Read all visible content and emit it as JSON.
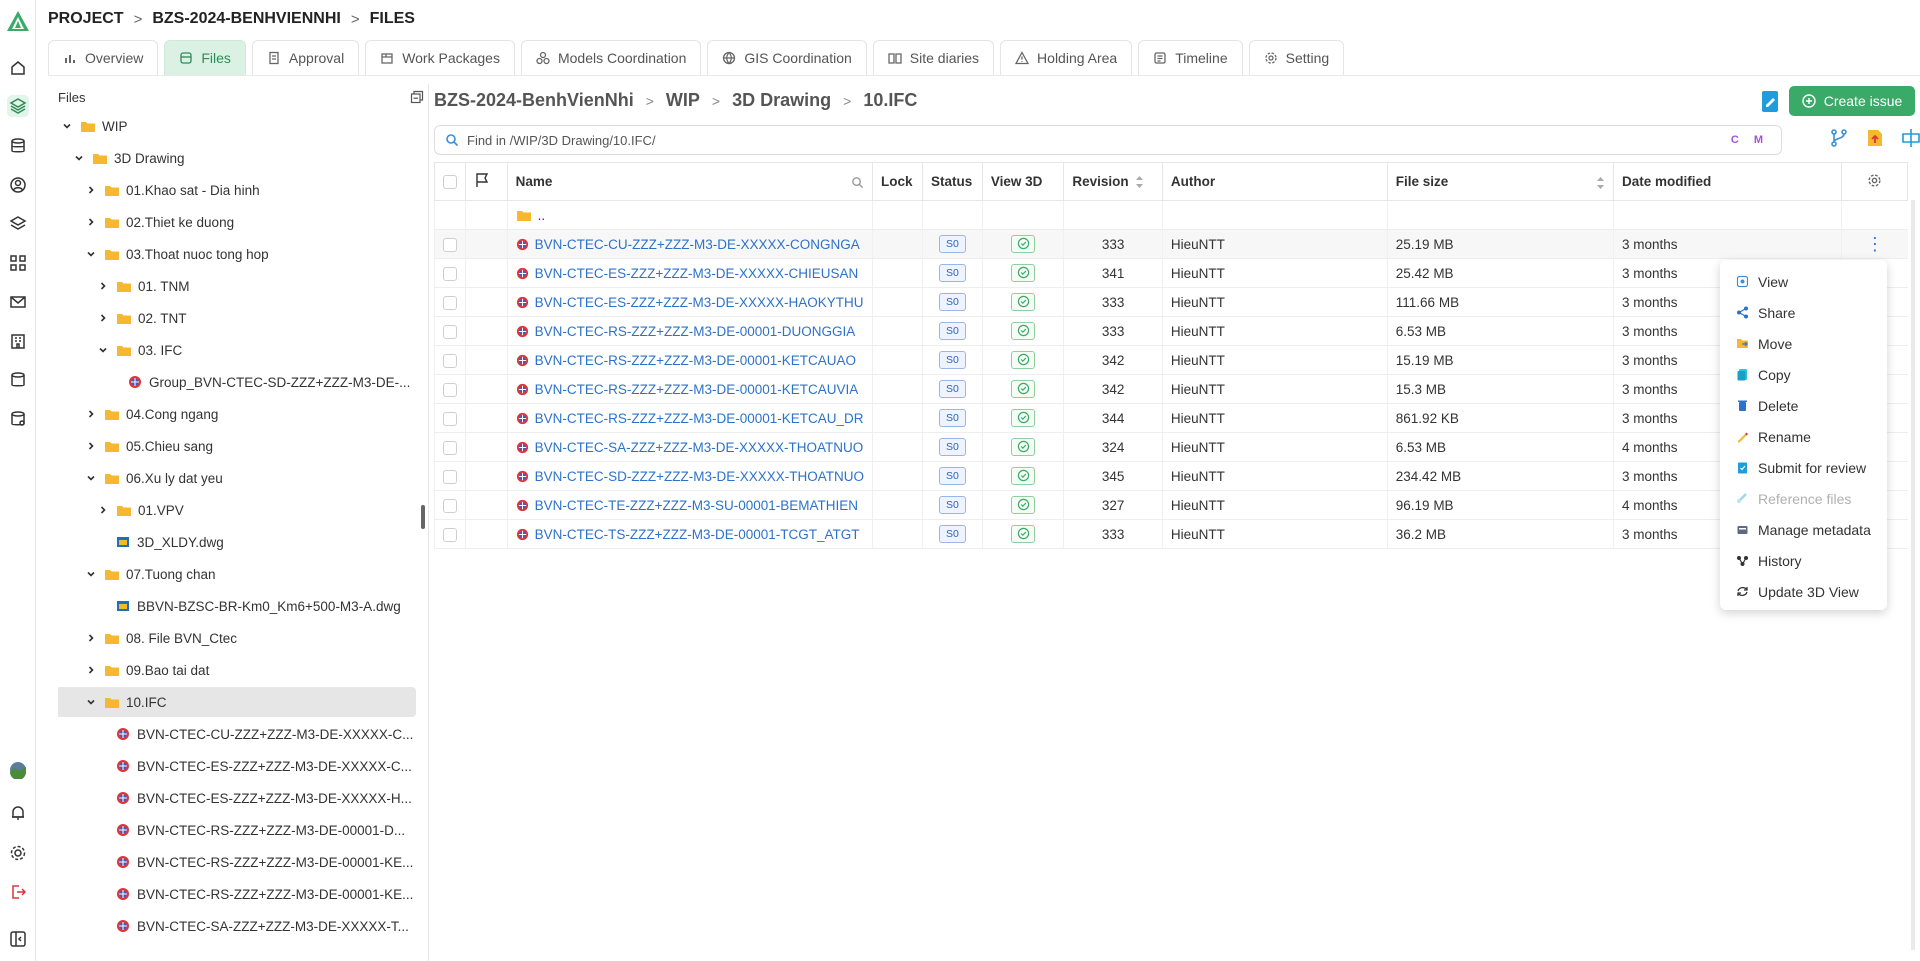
{
  "header": {
    "breadcrumb": [
      "PROJECT",
      "BZS-2024-BENHVIENNHI",
      "FILES"
    ],
    "tabs": [
      {
        "label": "Overview",
        "icon": "bar-chart-icon"
      },
      {
        "label": "Files",
        "icon": "files-icon",
        "active": true
      },
      {
        "label": "Approval",
        "icon": "document-icon"
      },
      {
        "label": "Work Packages",
        "icon": "package-icon"
      },
      {
        "label": "Models Coordination",
        "icon": "models-icon"
      },
      {
        "label": "GIS Coordination",
        "icon": "globe-icon"
      },
      {
        "label": "Site diaries",
        "icon": "book-icon"
      },
      {
        "label": "Holding Area",
        "icon": "warning-icon"
      },
      {
        "label": "Timeline",
        "icon": "timeline-icon"
      },
      {
        "label": "Setting",
        "icon": "gear-icon"
      }
    ]
  },
  "tree": {
    "title": "Files",
    "items": [
      {
        "label": "WIP",
        "type": "folder",
        "expanded": true
      },
      {
        "label": "3D Drawing",
        "type": "folder",
        "expanded": true
      },
      {
        "label": "01.Khao sat - Dia hinh",
        "type": "folder"
      },
      {
        "label": "02.Thiet ke duong",
        "type": "folder"
      },
      {
        "label": "03.Thoat nuoc tong hop",
        "type": "folder",
        "expanded": true
      },
      {
        "label": "01. TNM",
        "type": "folder"
      },
      {
        "label": "02. TNT",
        "type": "folder"
      },
      {
        "label": "03. IFC",
        "type": "folder",
        "expanded": true
      },
      {
        "label": "Group_BVN-CTEC-SD-ZZZ+ZZZ-M3-DE-...",
        "type": "ifc"
      },
      {
        "label": "04.Cong ngang",
        "type": "folder"
      },
      {
        "label": "05.Chieu sang",
        "type": "folder"
      },
      {
        "label": "06.Xu ly dat yeu",
        "type": "folder",
        "expanded": true
      },
      {
        "label": "01.VPV",
        "type": "folder"
      },
      {
        "label": "3D_XLDY.dwg",
        "type": "dwg"
      },
      {
        "label": "07.Tuong chan",
        "type": "folder",
        "expanded": true
      },
      {
        "label": "BBVN-BZSC-BR-Km0_Km6+500-M3-A.dwg",
        "type": "dwg"
      },
      {
        "label": "08. File BVN_Ctec",
        "type": "folder"
      },
      {
        "label": "09.Bao tai dat",
        "type": "folder"
      },
      {
        "label": "10.IFC",
        "type": "folder",
        "expanded": true,
        "selected": true
      },
      {
        "label": "BVN-CTEC-CU-ZZZ+ZZZ-M3-DE-XXXXX-C...",
        "type": "ifc"
      },
      {
        "label": "BVN-CTEC-ES-ZZZ+ZZZ-M3-DE-XXXXX-C...",
        "type": "ifc"
      },
      {
        "label": "BVN-CTEC-ES-ZZZ+ZZZ-M3-DE-XXXXX-H...",
        "type": "ifc"
      },
      {
        "label": "BVN-CTEC-RS-ZZZ+ZZZ-M3-DE-00001-D...",
        "type": "ifc"
      },
      {
        "label": "BVN-CTEC-RS-ZZZ+ZZZ-M3-DE-00001-KE...",
        "type": "ifc"
      },
      {
        "label": "BVN-CTEC-RS-ZZZ+ZZZ-M3-DE-00001-KE...",
        "type": "ifc"
      },
      {
        "label": "BVN-CTEC-SA-ZZZ+ZZZ-M3-DE-XXXXX-T...",
        "type": "ifc"
      }
    ]
  },
  "main": {
    "path": [
      "BZS-2024-BenhVienNhi",
      "WIP",
      "3D Drawing",
      "10.IFC"
    ],
    "create_issue_label": "Create issue",
    "search_placeholder": "Find in /WIP/3D Drawing/10.IFC/",
    "search_tags": "C M",
    "columns": [
      "Name",
      "Lock",
      "Status",
      "View 3D",
      "Revision",
      "Author",
      "File size",
      "Date modified"
    ],
    "parent_label": "..",
    "rows": [
      {
        "name": "BVN-CTEC-CU-ZZZ+ZZZ-M3-DE-XXXXX-CONGNGA",
        "status": "S0",
        "revision": "333",
        "author": "HieuNTT",
        "size": "25.19 MB",
        "modified": "3 months"
      },
      {
        "name": "BVN-CTEC-ES-ZZZ+ZZZ-M3-DE-XXXXX-CHIEUSAN",
        "status": "S0",
        "revision": "341",
        "author": "HieuNTT",
        "size": "25.42 MB",
        "modified": "3 months"
      },
      {
        "name": "BVN-CTEC-ES-ZZZ+ZZZ-M3-DE-XXXXX-HAOKYTHU",
        "status": "S0",
        "revision": "333",
        "author": "HieuNTT",
        "size": "111.66 MB",
        "modified": "3 months"
      },
      {
        "name": "BVN-CTEC-RS-ZZZ+ZZZ-M3-DE-00001-DUONGGIA",
        "status": "S0",
        "revision": "333",
        "author": "HieuNTT",
        "size": "6.53 MB",
        "modified": "3 months"
      },
      {
        "name": "BVN-CTEC-RS-ZZZ+ZZZ-M3-DE-00001-KETCAUAO",
        "status": "S0",
        "revision": "342",
        "author": "HieuNTT",
        "size": "15.19 MB",
        "modified": "3 months"
      },
      {
        "name": "BVN-CTEC-RS-ZZZ+ZZZ-M3-DE-00001-KETCAUVIA",
        "status": "S0",
        "revision": "342",
        "author": "HieuNTT",
        "size": "15.3 MB",
        "modified": "3 months"
      },
      {
        "name": "BVN-CTEC-RS-ZZZ+ZZZ-M3-DE-00001-KETCAU_DR",
        "status": "S0",
        "revision": "344",
        "author": "HieuNTT",
        "size": "861.92 KB",
        "modified": "3 months"
      },
      {
        "name": "BVN-CTEC-SA-ZZZ+ZZZ-M3-DE-XXXXX-THOATNUO",
        "status": "S0",
        "revision": "324",
        "author": "HieuNTT",
        "size": "6.53 MB",
        "modified": "4 months"
      },
      {
        "name": "BVN-CTEC-SD-ZZZ+ZZZ-M3-DE-XXXXX-THOATNUO",
        "status": "S0",
        "revision": "345",
        "author": "HieuNTT",
        "size": "234.42 MB",
        "modified": "3 months"
      },
      {
        "name": "BVN-CTEC-TE-ZZZ+ZZZ-M3-SU-00001-BEMATHIEN",
        "status": "S0",
        "revision": "327",
        "author": "HieuNTT",
        "size": "96.19 MB",
        "modified": "4 months"
      },
      {
        "name": "BVN-CTEC-TS-ZZZ+ZZZ-M3-DE-00001-TCGT_ATGT",
        "status": "S0",
        "revision": "333",
        "author": "HieuNTT",
        "size": "36.2 MB",
        "modified": "3 months"
      }
    ]
  },
  "context_menu": [
    {
      "label": "View",
      "icon": "view-icon"
    },
    {
      "label": "Share",
      "icon": "share-icon"
    },
    {
      "label": "Move",
      "icon": "move-icon"
    },
    {
      "label": "Copy",
      "icon": "copy-icon"
    },
    {
      "label": "Delete",
      "icon": "delete-icon"
    },
    {
      "label": "Rename",
      "icon": "rename-icon"
    },
    {
      "label": "Submit for review",
      "icon": "submit-icon"
    },
    {
      "label": "Reference files",
      "icon": "reference-icon",
      "disabled": true
    },
    {
      "label": "Manage metadata",
      "icon": "metadata-icon"
    },
    {
      "label": "History",
      "icon": "history-icon"
    },
    {
      "label": "Update 3D View",
      "icon": "update-icon"
    }
  ],
  "colors": {
    "brand_green": "#3aaa68",
    "link_blue": "#2d72c9",
    "folder_yellow": "#f5b82e"
  }
}
